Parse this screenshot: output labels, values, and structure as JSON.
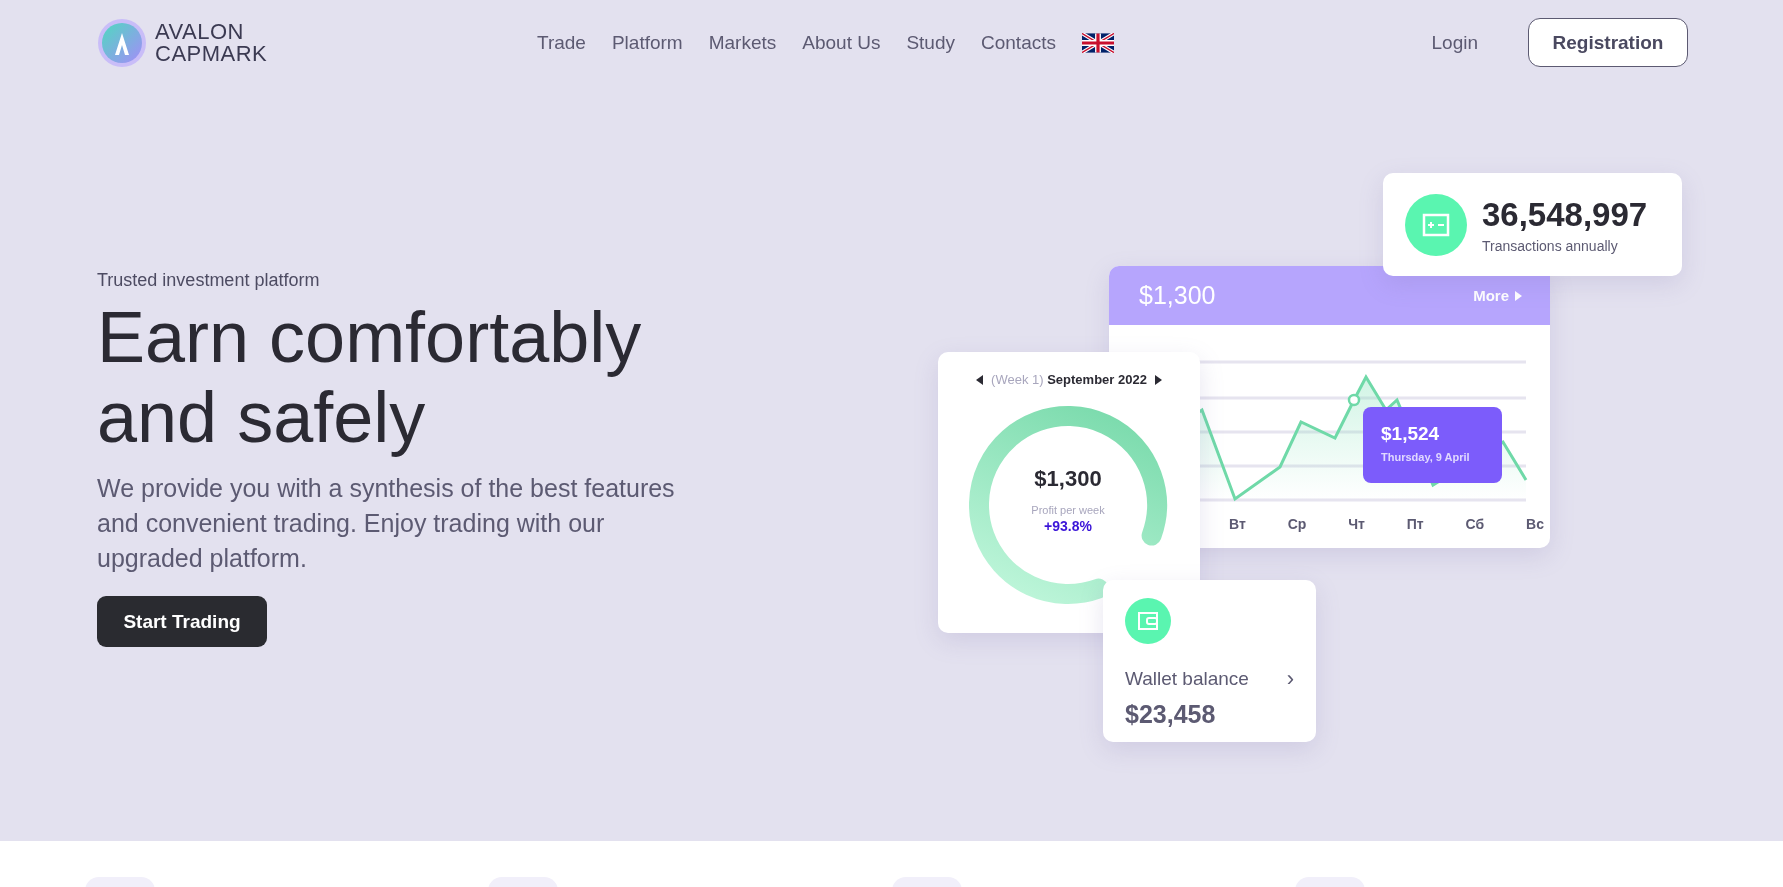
{
  "header": {
    "logo_lines": [
      "AVALON",
      "CAPMARK"
    ],
    "nav": [
      {
        "label": "Trade"
      },
      {
        "label": "Platform"
      },
      {
        "label": "Markets"
      },
      {
        "label": "About Us"
      },
      {
        "label": "Study"
      },
      {
        "label": "Contacts"
      }
    ],
    "login": "Login",
    "register": "Registration"
  },
  "hero": {
    "eyebrow": "Trusted investment platform",
    "title": "Earn comfortably and safely",
    "description": "We provide you with a synthesis of the best features and convenient trading. Enjoy trading with our upgraded platform.",
    "cta": "Start Trading"
  },
  "illustration": {
    "transactions": {
      "value": "36,548,997",
      "label": "Transactions annually"
    },
    "chart_card": {
      "amount": "$1,300",
      "more": "More",
      "days": [
        "Вт",
        "Ср",
        "Чт",
        "Пт",
        "Сб",
        "Вс"
      ],
      "tooltip": {
        "value": "$1,524",
        "date": "Thursday, 9 April"
      }
    },
    "week_card": {
      "week": "(Week 1)",
      "month": "September 2022",
      "amount": "$1,300",
      "caption": "Profit per week",
      "change": "+93.8%"
    },
    "wallet": {
      "label": "Wallet balance",
      "chevron": "›",
      "amount": "$23,458"
    }
  },
  "features": [
    {
      "kind": "card"
    },
    {
      "kind": "card"
    },
    {
      "kind": "card"
    },
    {
      "kind": "card"
    }
  ]
}
